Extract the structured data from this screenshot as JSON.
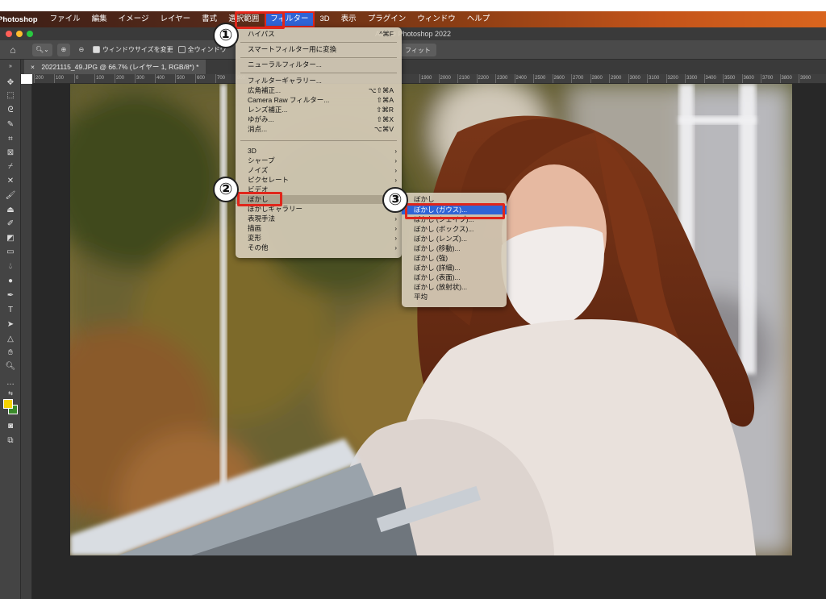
{
  "menubar": {
    "app": "Photoshop",
    "items": [
      "ファイル",
      "編集",
      "イメージ",
      "レイヤー",
      "書式",
      "選択範囲",
      "フィルター",
      "3D",
      "表示",
      "プラグイン",
      "ウィンドウ",
      "ヘルプ"
    ],
    "active_index": 6
  },
  "window": {
    "title": "Adobe Photoshop 2022"
  },
  "options": {
    "resize_window": "ウィンドウサイズを変更",
    "all_windows": "全ウィンドウ",
    "fit": "フィット"
  },
  "document": {
    "tab_title": "20221115_49.JPG @ 66.7% (レイヤー 1, RGB/8*) *",
    "close": "×"
  },
  "ruler_ticks": [
    "200",
    "100",
    "0",
    "100",
    "200",
    "300",
    "400",
    "500",
    "600",
    "700",
    "800",
    "1900",
    "2000",
    "2100",
    "2200",
    "2300",
    "2400",
    "2500",
    "2600",
    "2700",
    "2800",
    "2900",
    "3000",
    "3100",
    "3200",
    "3300",
    "3400",
    "3500",
    "3600",
    "3700",
    "3800",
    "3900"
  ],
  "filter_menu": {
    "items": [
      {
        "label": "ハイパス",
        "shortcut": "^⌘F"
      },
      {
        "label": "スマートフィルター用に変換"
      },
      {
        "label": "ニューラルフィルター..."
      },
      {
        "label": "フィルターギャラリー..."
      },
      {
        "label": "広角補正...",
        "shortcut": "⌥⇧⌘A"
      },
      {
        "label": "Camera Raw フィルター...",
        "shortcut": "⇧⌘A"
      },
      {
        "label": "レンズ補正...",
        "shortcut": "⇧⌘R"
      },
      {
        "label": "ゆがみ...",
        "shortcut": "⇧⌘X"
      },
      {
        "label": "消点...",
        "shortcut": "⌥⌘V"
      },
      {
        "label": "3D",
        "arrow": "›"
      },
      {
        "label": "シャープ",
        "arrow": "›"
      },
      {
        "label": "ノイズ",
        "arrow": "›"
      },
      {
        "label": "ピクセレート",
        "arrow": "›"
      },
      {
        "label": "ビデオ",
        "arrow": "›"
      },
      {
        "label": "ぼかし",
        "arrow": "›"
      },
      {
        "label": "ぼかしギャラリー",
        "arrow": "›"
      },
      {
        "label": "表現手法",
        "arrow": "›"
      },
      {
        "label": "描画",
        "arrow": "›"
      },
      {
        "label": "変形",
        "arrow": "›"
      },
      {
        "label": "その他",
        "arrow": "›"
      }
    ]
  },
  "blur_submenu": {
    "items": [
      "ぼかし",
      "ぼかし (ガウス)...",
      "ぼかし (シェイプ)...",
      "ぼかし (ボックス)...",
      "ぼかし (レンズ)...",
      "ぼかし (移動)...",
      "ぼかし (強)",
      "ぼかし (詳細)...",
      "ぼかし (表面)...",
      "ぼかし (放射状)...",
      "平均"
    ],
    "highlighted_index": 1
  },
  "annotations": {
    "step1": "①",
    "step2": "②",
    "step3": "③"
  },
  "colors": {
    "accent": "#2f64d6",
    "annotation_red": "#e0261b",
    "foreground_swatch": "#f5d300",
    "background_swatch": "#3a8a2a"
  }
}
